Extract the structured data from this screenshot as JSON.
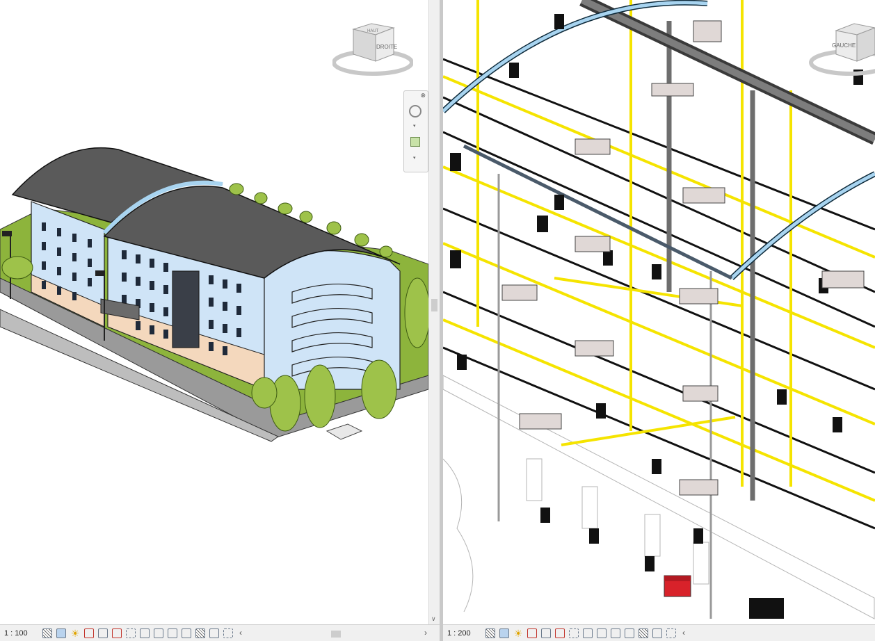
{
  "left_view": {
    "scale": "1 : 100",
    "viewcube": {
      "top_face": "HAUT",
      "front_face": "DROITE"
    }
  },
  "right_view": {
    "scale": "1 : 200",
    "viewcube": {
      "front_face": "GAUCHE"
    }
  },
  "colors": {
    "facade": "#cfe4f7",
    "roof": "#5a5a5a",
    "ground_floor": "#f4d8bd",
    "lawn": "#8db43c",
    "trees": "#9ec24a",
    "pipes_yellow": "#f5e400",
    "pipes_blue": "#a8d4f0",
    "fire_cabinet": "#d8222a"
  },
  "icons": [
    "detail-level-icon",
    "visual-style-icon",
    "sun-path-icon",
    "shadows-icon",
    "render-icon",
    "crop-view-icon",
    "show-crop-icon",
    "unlock-3d-icon",
    "temporary-hide-icon",
    "reveal-hidden-icon",
    "worksharing-icon",
    "design-options-icon",
    "analytical-model-icon",
    "highlight-displacement-icon"
  ]
}
